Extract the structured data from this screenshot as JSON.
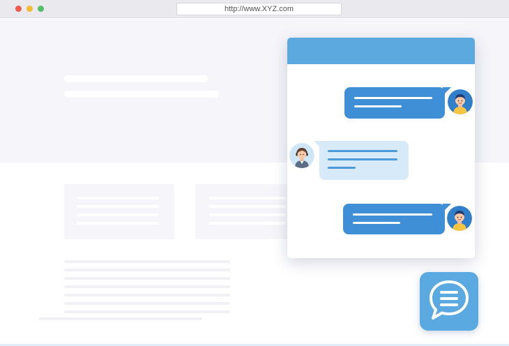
{
  "browser": {
    "url": "http://www.XYZ.com",
    "window_controls": [
      "close-dot",
      "minimize-dot",
      "maximize-dot"
    ]
  },
  "colors": {
    "chat_header": "#5ba9df",
    "bubble_outgoing": "#3f8fd6",
    "bubble_incoming": "#d6eaf9",
    "fab": "#5aaae1"
  },
  "chat": {
    "messages": [
      {
        "direction": "outgoing",
        "avatar": "male-user-avatar"
      },
      {
        "direction": "incoming",
        "avatar": "female-agent-avatar"
      },
      {
        "direction": "outgoing",
        "avatar": "male-user-avatar"
      }
    ]
  },
  "fab": {
    "icon": "chat-bubble-icon"
  }
}
